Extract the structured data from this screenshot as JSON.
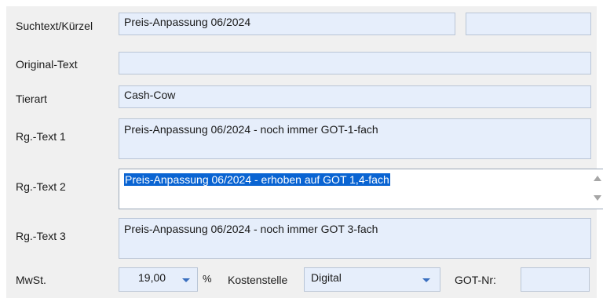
{
  "form": {
    "suchtext": {
      "label": "Suchtext/Kürzel",
      "value": "Preis-Anpassung 06/2024",
      "extra_value": ""
    },
    "original_text": {
      "label": "Original-Text",
      "value": ""
    },
    "tierart": {
      "label": "Tierart",
      "value": "Cash-Cow"
    },
    "rg_text_1": {
      "label": "Rg.-Text 1",
      "value": "Preis-Anpassung 06/2024 - noch immer GOT-1-fach"
    },
    "rg_text_2": {
      "label": "Rg.-Text 2",
      "value": "Preis-Anpassung 06/2024 - erhoben auf GOT 1,4-fach"
    },
    "rg_text_3": {
      "label": "Rg.-Text 3",
      "value": "Preis-Anpassung 06/2024 - noch immer GOT 3-fach"
    },
    "mwst": {
      "label": "MwSt.",
      "value": "19,00",
      "unit": "%"
    },
    "kostenstelle": {
      "label": "Kostenstelle",
      "value": "Digital"
    },
    "got_nr": {
      "label": "GOT-Nr:",
      "value": ""
    }
  }
}
